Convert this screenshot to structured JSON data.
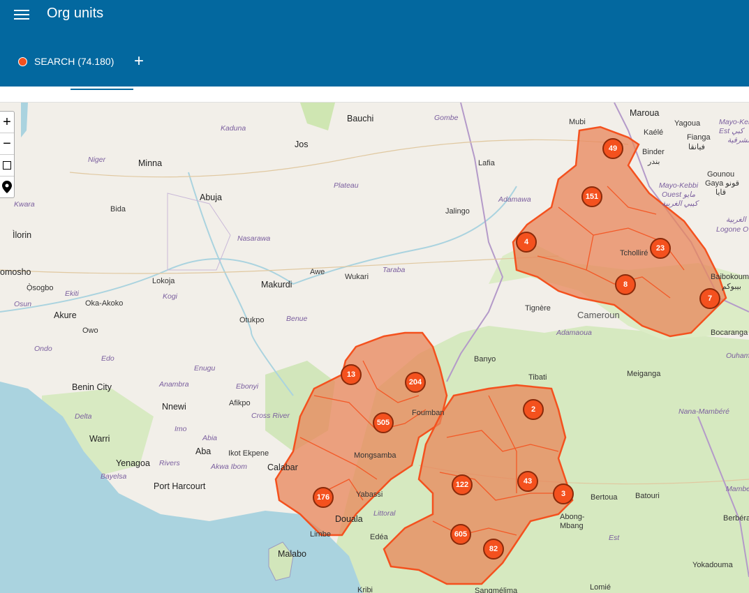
{
  "app": {
    "title": "Org units"
  },
  "tabs": [
    {
      "label": "SEARCH (74.180)",
      "color": "#f4511e"
    }
  ],
  "map": {
    "labels": {
      "bauchi": "Bauchi",
      "gombe": "Gombe",
      "kaduna": "Kaduna",
      "jos": "Jos",
      "niger": "Niger",
      "minna": "Minna",
      "plateau": "Plateau",
      "lafia": "Lafia",
      "kwara": "Kwara",
      "abuja": "Abuja",
      "bida": "Bida",
      "jalingo": "Jalingo",
      "adamawa": "Adamawa",
      "nasarawa": "Nasarawa",
      "ilorin": "Ìlorin",
      "omosho": "omosho",
      "awe": "Awe",
      "wukari": "Wukari",
      "taraba": "Taraba",
      "osogbo": "Ọ̀sogbo",
      "lokoja": "Lokoja",
      "makurdi": "Makurdi",
      "osun": "Osun",
      "ekiti": "Ekiti",
      "kogi": "Kogi",
      "oka_akoko": "Oka-Akoko",
      "benue": "Benue",
      "akure": "Akure",
      "otukpo": "Otukpo",
      "owo": "Owo",
      "ondo": "Ondo",
      "edo": "Edo",
      "enugu": "Enugu",
      "benin_city": "Benin City",
      "anambra": "Anambra",
      "ebonyi": "Ebonyi",
      "nnewi": "Nnewi",
      "afikpo": "Afikpo",
      "cross_river": "Cross River",
      "delta": "Delta",
      "imo": "Imo",
      "warri": "Warri",
      "abia": "Abia",
      "aba": "Aba",
      "ikot_ekpene": "Ikot Ekpene",
      "yenagoa": "Yenagoa",
      "rivers": "Rivers",
      "akwa_ibom": "Akwa Ibom",
      "bayelsa": "Bayelsa",
      "port_harcourt": "Port Harcourt",
      "calabar": "Calabar",
      "malabo": "Malabo",
      "douala": "Douala",
      "limbe": "Limbe",
      "yabassi": "Yabassi",
      "littoral": "Littoral",
      "edea": "Edéa",
      "mongsamba": "Mongsamba",
      "mubi": "Mubi",
      "maroua": "Maroua",
      "yagoua": "Yagoua",
      "kaele": "Kaélé",
      "fianga": "Fianga",
      "fianga_ar": "فيانقا",
      "mayo_kebbi_est": "Mayo-Kebbi",
      "mayo_kebbi_est2": "Est كبي",
      "mayo_kebbi_est3": "الشرقية",
      "binder": "Binder",
      "binder_ar": "بندر",
      "gounou_gaya": "Gounou",
      "gounou_gaya2": "Gaya قونو",
      "gounou_gaya3": "قايا",
      "mayo_kebbi_ouest": "Mayo-Kebbi",
      "mayo_kebbi_ouest2": "Ouest مايو",
      "mayo_kebbi_ouest3": "كيبي الغربية",
      "logone": "الغربية",
      "logone2": "Logone O",
      "tchollire": "Tcholliré",
      "baibokoum": "Baibokoum",
      "baibokoum2": "بيبوكم",
      "tignere": "Tignère",
      "cameroun": "Cameroun",
      "adamaoua": "Adamaoua",
      "bocaranga": "Bocaranga",
      "ouham": "Ouham",
      "banyo": "Banyo",
      "tibati": "Tibati",
      "meiganga": "Meiganga",
      "nana_mambere": "Nana-Mambéré",
      "bertoua": "Bertoua",
      "batouri": "Batouri",
      "abong_mbang": "Abong-",
      "abong_mbang2": "Mbang",
      "est": "Est",
      "mambe": "Mambe",
      "berbera": "Berbéra",
      "yokadouma": "Yokadouma",
      "lomie": "Lomié",
      "sangmelima": "Sangmélima",
      "kribi": "Kribi",
      "foumban": "Foumban"
    },
    "clusters": [
      "49",
      "151",
      "4",
      "23",
      "8",
      "7",
      "13",
      "204",
      "505",
      "2",
      "122",
      "43",
      "3",
      "176",
      "605",
      "82"
    ],
    "colors": {
      "water": "#aad3df",
      "land": "#f2efe9",
      "forest": "#cfe6b2",
      "orgunit_fill": "#e8855a",
      "orgunit_stroke": "#f4511e"
    }
  },
  "controls": {
    "zoom_in": "+",
    "zoom_out": "−"
  }
}
